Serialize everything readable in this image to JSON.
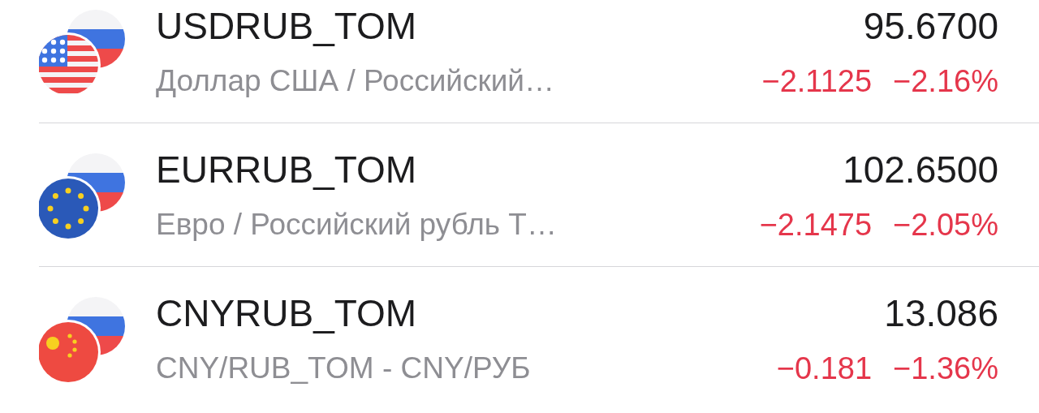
{
  "rows": [
    {
      "ticker": "USDRUB_TOM",
      "name": "Доллар США / Российский…",
      "price": "95.6700",
      "change": "−2.1125",
      "change_pct": "−2.16%"
    },
    {
      "ticker": "EURRUB_TOM",
      "name": "Евро / Российский рубль Т…",
      "price": "102.6500",
      "change": "−2.1475",
      "change_pct": "−2.05%"
    },
    {
      "ticker": "CNYRUB_TOM",
      "name": "CNY/RUB_TOM - CNY/РУБ",
      "price": "13.086",
      "change": "−0.181",
      "change_pct": "−1.36%"
    }
  ]
}
